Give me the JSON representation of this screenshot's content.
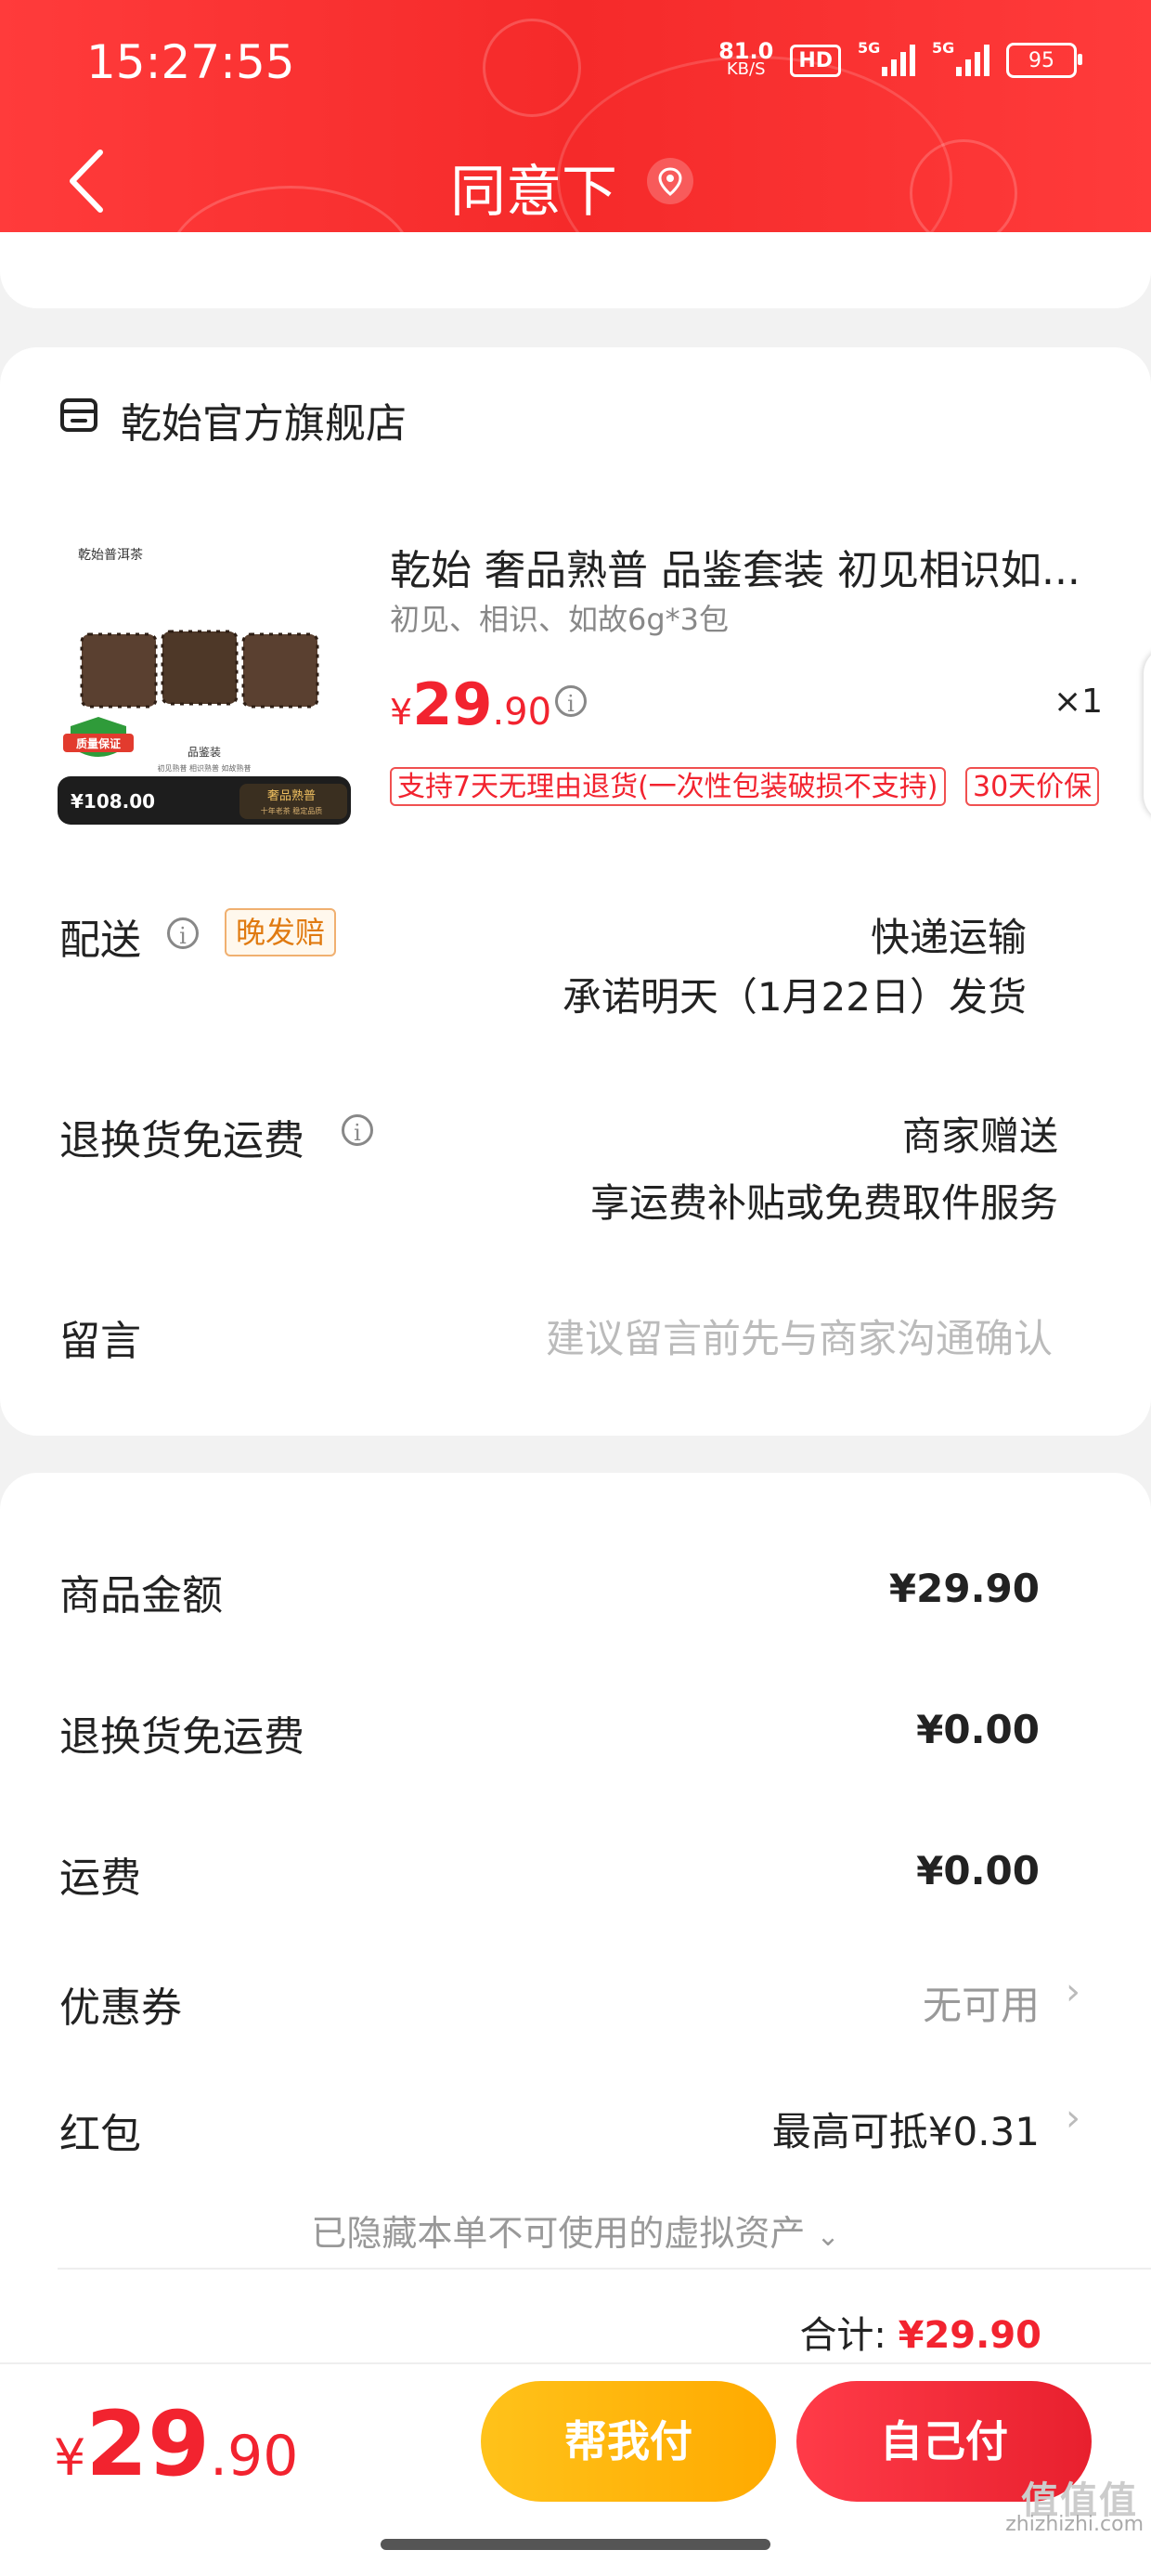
{
  "status_bar": {
    "time": "15:27:55",
    "net_speed": "81.0",
    "net_unit": "KB/S",
    "hd_label": "HD",
    "sim1": "5G",
    "sim2": "5G",
    "battery": "95"
  },
  "header": {
    "title": "同意下"
  },
  "shop": {
    "name": "乾始官方旗舰店"
  },
  "product": {
    "name": "乾始 奢品熟普 品鉴套装 初见相识如...",
    "spec": "初见、相识、如故6g*3包",
    "price_symbol": "¥",
    "price_int": "29",
    "price_dec": ".90",
    "qty": "×1",
    "tags": [
      "支持7天无理由退货(一次性包装破损不支持)",
      "30天价保"
    ],
    "thumb": {
      "brand": "乾始普洱茶",
      "label": "品鉴装",
      "sub": "初见熟普 相识熟普 如故熟普",
      "badge": "质量保证",
      "price": "¥108.00",
      "tag": "奢品熟普",
      "tag_sub": "十年老茶 稳定品质"
    }
  },
  "delivery": {
    "label": "配送",
    "badge": "晚发赔",
    "method": "快递运输",
    "promise": "承诺明天（1月22日）发货"
  },
  "return_shipping": {
    "label": "退换货免运费",
    "provider": "商家赠送",
    "desc": "享运费补贴或免费取件服务"
  },
  "message": {
    "label": "留言",
    "placeholder": "建议留言前先与商家沟通确认"
  },
  "summary": {
    "goods_label": "商品金额",
    "goods_value": "¥29.90",
    "return_label": "退换货免运费",
    "return_value": "¥0.00",
    "freight_label": "运费",
    "freight_value": "¥0.00",
    "coupon_label": "优惠券",
    "coupon_value": "无可用",
    "redpacket_label": "红包",
    "redpacket_value": "最高可抵¥0.31",
    "hidden_note": "已隐藏本单不可使用的虚拟资产",
    "total_label": "合计:",
    "total_value": "¥29.90"
  },
  "bottom": {
    "price_symbol": "¥",
    "price_int": "29",
    "price_dec": ".90",
    "friend_pay": "帮我付",
    "self_pay": "自己付"
  },
  "watermark": {
    "logo": "值值值",
    "text": "zhizhizhi.com"
  },
  "colors": {
    "brand_red": "#f2232f",
    "friend_btn": "#ffb300",
    "header_bg": "#f52a2a"
  }
}
